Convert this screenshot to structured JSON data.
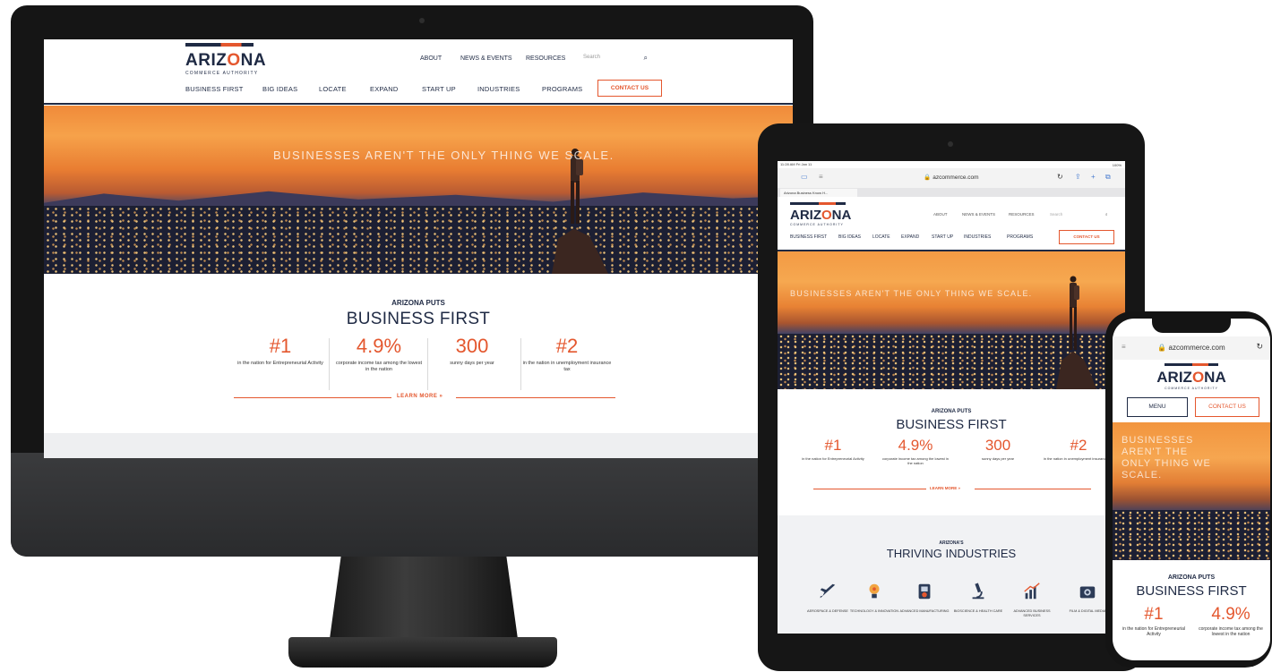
{
  "desktop": {
    "logo": {
      "main_before": "ARIZ",
      "main_o": "O",
      "main_after": "NA",
      "sub": "COMMERCE AUTHORITY"
    },
    "utility_nav": [
      "ABOUT",
      "NEWS & EVENTS",
      "RESOURCES"
    ],
    "search": {
      "placeholder": "Search",
      "icon": "search-icon"
    },
    "main_nav": [
      "BUSINESS FIRST",
      "BIG IDEAS",
      "LOCATE",
      "EXPAND",
      "START UP",
      "INDUSTRIES",
      "PROGRAMS"
    ],
    "contact_label": "CONTACT US",
    "hero_text": "BUSINESSES AREN'T THE ONLY THING WE SCALE.",
    "puts_title": "ARIZONA PUTS",
    "puts_heading": "BUSINESS FIRST",
    "stats": [
      {
        "value": "#1",
        "text": "in the nation for Entrepreneurial Activity"
      },
      {
        "value": "4.9%",
        "text": "corporate income tax among the lowest in the nation"
      },
      {
        "value": "300",
        "text": "sunny days per year"
      },
      {
        "value": "#2",
        "text": "in the nation in unemployment insurance tax"
      }
    ],
    "learn_more": "LEARN MORE »"
  },
  "tablet": {
    "status_time": "11:28 AM  Fri Jan 11",
    "status_right": "100%",
    "url": "🔒 azcommerce.com",
    "tab_label": "Arizona Business Know H...",
    "logo": {
      "main_before": "ARIZ",
      "main_o": "O",
      "main_after": "NA",
      "sub": "COMMERCE AUTHORITY"
    },
    "utility_nav": [
      "ABOUT",
      "NEWS & EVENTS",
      "RESOURCES",
      "Search"
    ],
    "main_nav": [
      "BUSINESS FIRST",
      "BIG IDEAS",
      "LOCATE",
      "EXPAND",
      "START UP",
      "INDUSTRIES",
      "PROGRAMS"
    ],
    "contact_label": "CONTACT US",
    "hero_text": "BUSINESSES AREN'T THE ONLY THING WE SCALE.",
    "puts_title": "ARIZONA PUTS",
    "puts_heading": "BUSINESS FIRST",
    "stats": [
      {
        "value": "#1",
        "text": "in the nation for Entrepreneurial Activity"
      },
      {
        "value": "4.9%",
        "text": "corporate income tax among the lowest in the nation"
      },
      {
        "value": "300",
        "text": "sunny days per year"
      },
      {
        "value": "#2",
        "text": "in the nation in unemployment insurance tax"
      }
    ],
    "learn_more": "LEARN MORE »",
    "industries_title": "ARIZONA'S",
    "industries_heading": "THRIVING INDUSTRIES",
    "industries": [
      {
        "label": "AEROSPACE & DEFENSE",
        "icon": "airplane-icon"
      },
      {
        "label": "TECHNOLOGY & INNOVATION",
        "icon": "lightbulb-icon"
      },
      {
        "label": "ADVANCED MANUFACTURING",
        "icon": "manufacturing-icon"
      },
      {
        "label": "BIOSCIENCE & HEALTH CARE",
        "icon": "microscope-icon"
      },
      {
        "label": "ADVANCED BUSINESS SERVICES",
        "icon": "growth-chart-icon"
      },
      {
        "label": "FILM & DIGITAL MEDIA",
        "icon": "camera-icon"
      }
    ]
  },
  "phone": {
    "url": "🔒 azcommerce.com",
    "logo": {
      "main_before": "ARIZ",
      "main_o": "O",
      "main_after": "NA",
      "sub": "COMMERCE AUTHORITY"
    },
    "menu_label": "MENU",
    "contact_label": "CONTACT US",
    "hero_text": "BUSINESSES AREN'T THE ONLY THING WE SCALE.",
    "puts_title": "ARIZONA PUTS",
    "puts_heading": "BUSINESS FIRST",
    "stats": [
      {
        "value": "#1",
        "text": "in the nation for Entrepreneurial Activity"
      },
      {
        "value": "4.9%",
        "text": "corporate income tax among the lowest in the nation"
      }
    ]
  },
  "colors": {
    "navy": "#1f2a44",
    "orange": "#e4572e"
  }
}
